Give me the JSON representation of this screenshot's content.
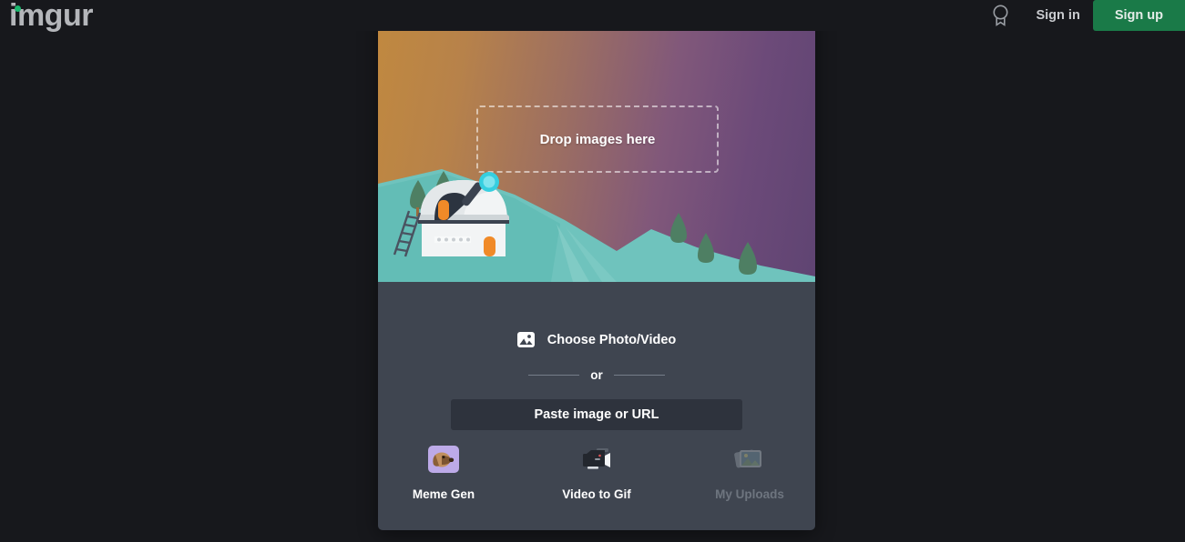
{
  "header": {
    "logo_text": "imgur",
    "logo_dot_color": "#1bb76e",
    "badge_icon": "award-badge-icon",
    "sign_in_label": "Sign in",
    "sign_up_label": "Sign up",
    "sign_up_color": "#1a7a48"
  },
  "upload_card": {
    "close_icon": "close-circle-icon",
    "dropzone_text": "Drop images here",
    "gradient_from": "#c1893f",
    "gradient_to": "#5f4472",
    "illustration": "observatory-on-hillside-illustration",
    "panel_color": "#3f4550",
    "choose": {
      "icon": "photo-image-icon",
      "label": "Choose Photo/Video"
    },
    "divider_label": "or",
    "paste_button_label": "Paste image or URL",
    "tools": [
      {
        "name": "meme-gen",
        "icon": "dog-face-icon",
        "label": "Meme Gen",
        "disabled": false
      },
      {
        "name": "video-to-gif",
        "icon": "camcorder-icon",
        "label": "Video to Gif",
        "disabled": false
      },
      {
        "name": "my-uploads",
        "icon": "stacked-photos-icon",
        "label": "My Uploads",
        "disabled": true
      }
    ]
  }
}
